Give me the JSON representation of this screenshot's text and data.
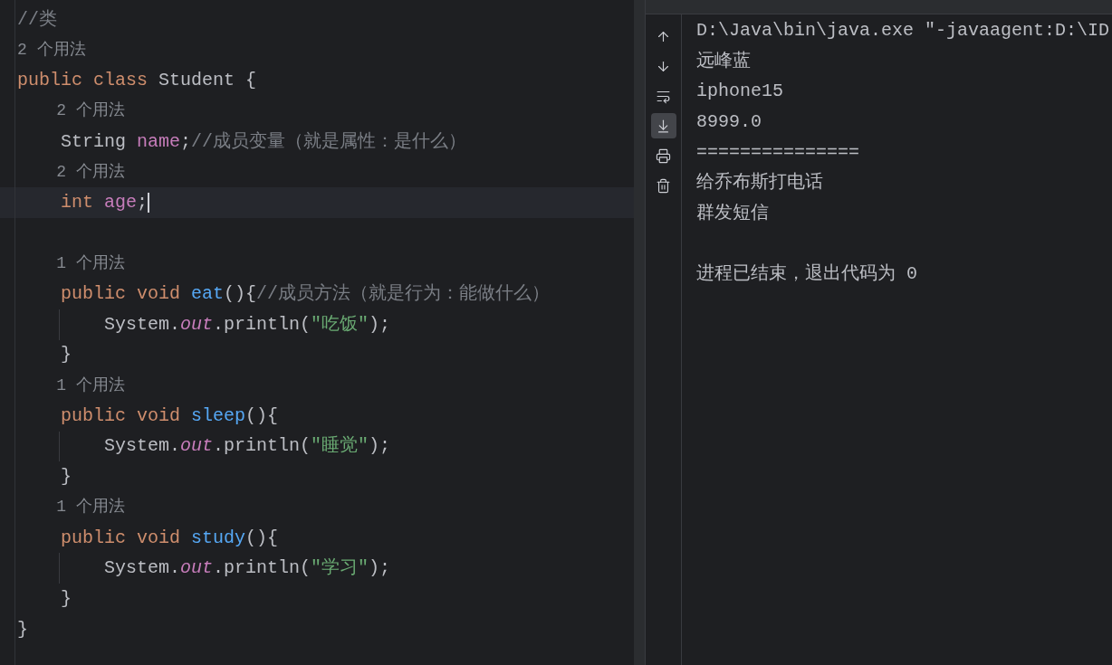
{
  "editor": {
    "lines": [
      {
        "kind": "code",
        "current": false,
        "tokens": [
          {
            "kind": "comment",
            "text": "//类"
          }
        ]
      },
      {
        "kind": "hint",
        "current": false,
        "text": "2 个用法"
      },
      {
        "kind": "code",
        "current": false,
        "tokens": [
          {
            "kind": "keyword",
            "text": "public class "
          },
          {
            "kind": "plain",
            "text": "Student {"
          }
        ]
      },
      {
        "kind": "hint",
        "current": false,
        "text": "    2 个用法"
      },
      {
        "kind": "code",
        "current": false,
        "tokens": [
          {
            "kind": "plain",
            "text": "    String "
          },
          {
            "kind": "field",
            "text": "name"
          },
          {
            "kind": "plain",
            "text": ";"
          },
          {
            "kind": "comment",
            "text": "//成员变量（就是属性：是什么）"
          }
        ]
      },
      {
        "kind": "hint",
        "current": false,
        "text": "    2 个用法"
      },
      {
        "kind": "code",
        "current": true,
        "tokens": [
          {
            "kind": "keyword",
            "text": "    int "
          },
          {
            "kind": "field",
            "text": "age"
          },
          {
            "kind": "plain",
            "text": ";"
          }
        ]
      },
      {
        "kind": "blank",
        "current": false
      },
      {
        "kind": "hint",
        "current": false,
        "text": "    1 个用法"
      },
      {
        "kind": "code",
        "current": false,
        "tokens": [
          {
            "kind": "keyword",
            "text": "    public void "
          },
          {
            "kind": "method",
            "text": "eat"
          },
          {
            "kind": "plain",
            "text": "(){"
          },
          {
            "kind": "comment",
            "text": "//成员方法（就是行为：能做什么）"
          }
        ]
      },
      {
        "kind": "body",
        "current": false,
        "tokens": [
          {
            "kind": "plain",
            "text": "System."
          },
          {
            "kind": "static",
            "text": "out"
          },
          {
            "kind": "plain",
            "text": ".println("
          },
          {
            "kind": "string",
            "text": "\"吃饭\""
          },
          {
            "kind": "plain",
            "text": ");"
          }
        ]
      },
      {
        "kind": "code",
        "current": false,
        "tokens": [
          {
            "kind": "plain",
            "text": "    }"
          }
        ]
      },
      {
        "kind": "hint",
        "current": false,
        "text": "    1 个用法"
      },
      {
        "kind": "code",
        "current": false,
        "tokens": [
          {
            "kind": "keyword",
            "text": "    public void "
          },
          {
            "kind": "method",
            "text": "sleep"
          },
          {
            "kind": "plain",
            "text": "(){"
          }
        ]
      },
      {
        "kind": "body",
        "current": false,
        "tokens": [
          {
            "kind": "plain",
            "text": "System."
          },
          {
            "kind": "static",
            "text": "out"
          },
          {
            "kind": "plain",
            "text": ".println("
          },
          {
            "kind": "string",
            "text": "\"睡觉\""
          },
          {
            "kind": "plain",
            "text": ");"
          }
        ]
      },
      {
        "kind": "code",
        "current": false,
        "tokens": [
          {
            "kind": "plain",
            "text": "    }"
          }
        ]
      },
      {
        "kind": "hint",
        "current": false,
        "text": "    1 个用法"
      },
      {
        "kind": "code",
        "current": false,
        "tokens": [
          {
            "kind": "keyword",
            "text": "    public void "
          },
          {
            "kind": "method",
            "text": "study"
          },
          {
            "kind": "plain",
            "text": "(){"
          }
        ]
      },
      {
        "kind": "body",
        "current": false,
        "tokens": [
          {
            "kind": "plain",
            "text": "System."
          },
          {
            "kind": "static",
            "text": "out"
          },
          {
            "kind": "plain",
            "text": ".println("
          },
          {
            "kind": "string",
            "text": "\"学习\""
          },
          {
            "kind": "plain",
            "text": ");"
          }
        ]
      },
      {
        "kind": "code",
        "current": false,
        "tokens": [
          {
            "kind": "plain",
            "text": "    }"
          }
        ]
      },
      {
        "kind": "code",
        "current": false,
        "tokens": [
          {
            "kind": "plain",
            "text": "}"
          }
        ]
      }
    ]
  },
  "console": {
    "tools": [
      {
        "kind": "up",
        "selected": false
      },
      {
        "kind": "down",
        "selected": false
      },
      {
        "kind": "wrap",
        "selected": false
      },
      {
        "kind": "scroll-end",
        "selected": true
      },
      {
        "kind": "print",
        "selected": false
      },
      {
        "kind": "trash",
        "selected": false
      }
    ],
    "lines": [
      {
        "kind": "output",
        "text": "D:\\Java\\bin\\java.exe \"-javaagent:D:\\ID"
      },
      {
        "kind": "output",
        "text": "远峰蓝"
      },
      {
        "kind": "output",
        "text": "iphone15"
      },
      {
        "kind": "output",
        "text": "8999.0"
      },
      {
        "kind": "output",
        "text": "==============="
      },
      {
        "kind": "output",
        "text": "给乔布斯打电话"
      },
      {
        "kind": "output",
        "text": "群发短信"
      },
      {
        "kind": "exit",
        "text": "进程已结束，退出代码为 0"
      }
    ]
  }
}
